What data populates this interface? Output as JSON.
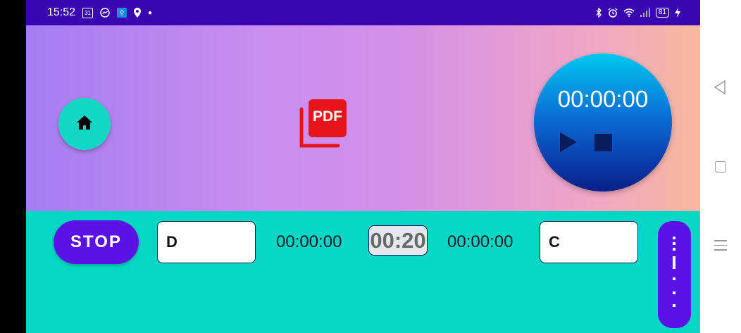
{
  "status_bar": {
    "time": "15:52",
    "calendar_day": "31",
    "battery": "81",
    "icons_left": [
      "calendar-icon",
      "messenger-icon",
      "box-icon",
      "location-icon",
      "dot-icon"
    ],
    "icons_right": [
      "bluetooth-icon",
      "alarm-icon",
      "wifi-icon",
      "signal-icon",
      "battery-icon",
      "charging-icon"
    ]
  },
  "top_panel": {
    "home_icon": "home-icon",
    "pdf_label": "PDF",
    "timer": {
      "display": "00:00:00",
      "play_icon": "play-icon",
      "stop_icon": "stop-icon"
    }
  },
  "bottom_panel": {
    "stop_label": "STOP",
    "left_box_value": "D",
    "left_time": "00:00:00",
    "mini_timer": "00:20",
    "right_time": "00:00:00",
    "right_box_value": "C",
    "menu_icon": "vertical-dots-icon"
  },
  "colors": {
    "status_bar": "#3a06b0",
    "accent_purple": "#5a12e6",
    "teal": "#04d8c4",
    "pdf_red": "#e8141c"
  }
}
